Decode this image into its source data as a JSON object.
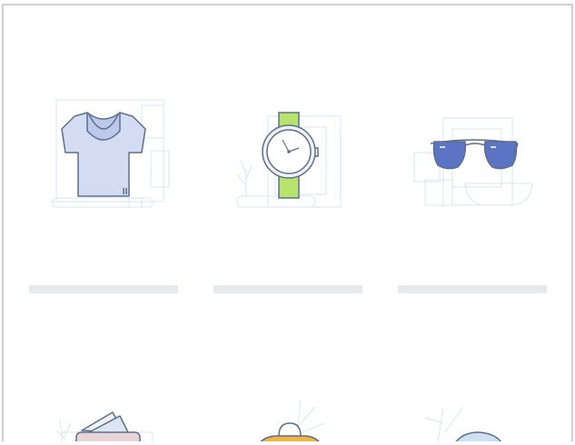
{
  "products": [
    {
      "icon": "t-shirt-icon",
      "title": ""
    },
    {
      "icon": "wristwatch-icon",
      "title": ""
    },
    {
      "icon": "sunglasses-icon",
      "title": ""
    },
    {
      "icon": "wallet-icon",
      "title": ""
    },
    {
      "icon": "bag-icon",
      "title": ""
    },
    {
      "icon": "cap-icon",
      "title": ""
    }
  ],
  "colors": {
    "outline": "#5c6f8e",
    "shirt_fill": "#d4dcf3",
    "watch_strap": "#b7e46a",
    "lens_blue": "#5b74c3",
    "bag_orange": "#f2b543",
    "wallet_pink": "#e7d5d8",
    "cap_blue": "#cfe0f3",
    "sketch_line": "#d7e6f4",
    "placeholder_bar": "#e8e8ef",
    "frame_border": "#d0d0d2"
  }
}
